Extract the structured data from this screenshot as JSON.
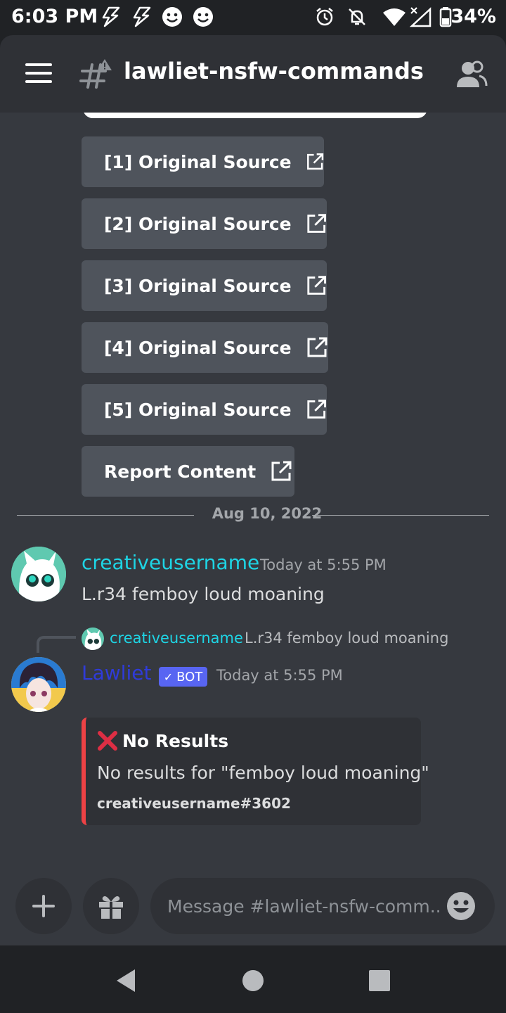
{
  "status_bar": {
    "time": "6:03 PM",
    "battery": "34%"
  },
  "header": {
    "channel_name": "lawliet-nsfw-commands"
  },
  "link_buttons": [
    {
      "label": "[1] Original Source"
    },
    {
      "label": "[2] Original Source"
    },
    {
      "label": "[3] Original Source"
    },
    {
      "label": "[4] Original Source"
    },
    {
      "label": "[5] Original Source"
    },
    {
      "label": "Report Content"
    }
  ],
  "date_divider": "Aug 10, 2022",
  "messages": [
    {
      "author": "creativeusername",
      "timestamp": "Today at 5:55 PM",
      "text": "L.r34 femboy loud moaning",
      "author_color": "#1ed5e5"
    },
    {
      "author": "Lawliet",
      "badge": "BOT",
      "timestamp": "Today at 5:55 PM",
      "author_color": "#2f3bd9",
      "reply": {
        "author": "creativeusername",
        "text": "L.r34 femboy loud moaning"
      },
      "embed": {
        "title": "No Results",
        "description": "No results for \"femboy loud moaning\"",
        "footer": "creativeusername#3602",
        "accent_color": "#ed4245"
      }
    }
  ],
  "composer": {
    "placeholder": "Message #lawliet-nsfw-comm..."
  },
  "icons": [
    "menu-icon",
    "hash-warning-icon",
    "members-icon",
    "external-link-icon",
    "cross-mark-icon",
    "plus-icon",
    "gift-icon",
    "emoji-icon",
    "back-icon",
    "home-icon",
    "recents-icon"
  ]
}
